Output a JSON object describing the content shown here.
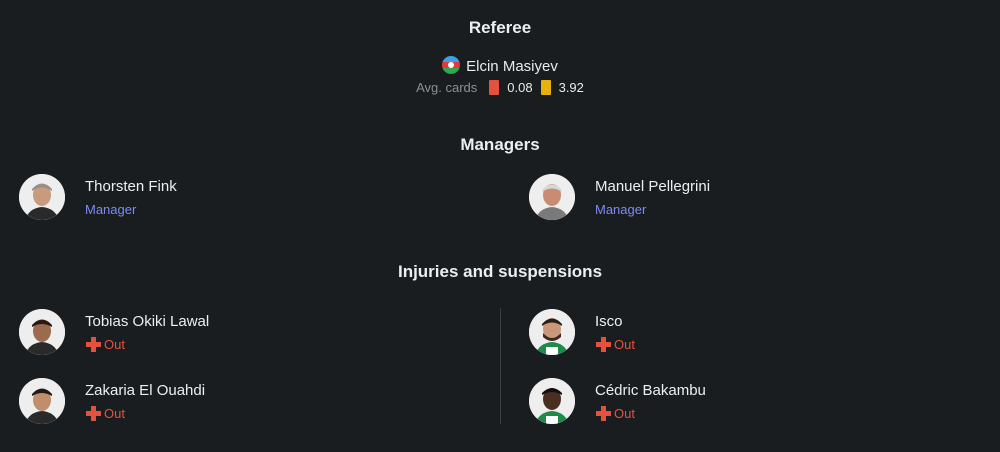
{
  "referee": {
    "title": "Referee",
    "name": "Elcin Masiyev",
    "flag_icon": "azerbaijan-flag-icon",
    "avg_cards_label": "Avg. cards",
    "red_cards": "0.08",
    "yellow_cards": "3.92"
  },
  "managers": {
    "title": "Managers",
    "home": {
      "name": "Thorsten Fink",
      "role": "Manager"
    },
    "away": {
      "name": "Manuel Pellegrini",
      "role": "Manager"
    }
  },
  "injuries": {
    "title": "Injuries and suspensions",
    "home": [
      {
        "name": "Tobias Okiki Lawal",
        "status": "Out"
      },
      {
        "name": "Zakaria El Ouahdi",
        "status": "Out"
      }
    ],
    "away": [
      {
        "name": "Isco",
        "status": "Out"
      },
      {
        "name": "Cédric Bakambu",
        "status": "Out"
      }
    ]
  },
  "colors": {
    "background": "#1a1d20",
    "manager_role": "#7c8cf0",
    "out_status": "#e4523f",
    "red_card": "#e4523f",
    "yellow_card": "#e7b20c"
  }
}
